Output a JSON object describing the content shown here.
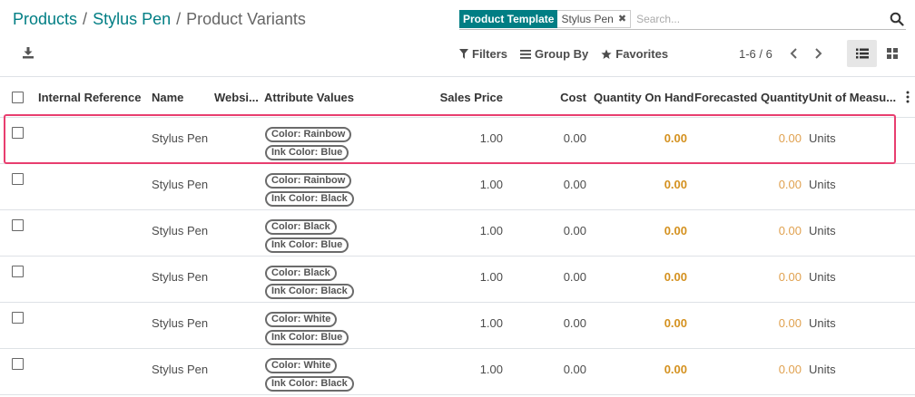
{
  "breadcrumb": {
    "root": "Products",
    "sep1": "/",
    "product": "Stylus Pen",
    "sep2": "/",
    "current": "Product Variants"
  },
  "search": {
    "facet_label": "Product Template",
    "facet_value": "Stylus Pen",
    "placeholder": "Search..."
  },
  "toolbar": {
    "filters": "Filters",
    "group_by": "Group By",
    "favorites": "Favorites",
    "pager": "1-6 / 6"
  },
  "columns": {
    "internal_reference": "Internal Reference",
    "name": "Name",
    "website": "Websi...",
    "attribute_values": "Attribute Values",
    "sales_price": "Sales Price",
    "cost": "Cost",
    "qty_on_hand": "Quantity On Hand",
    "forecasted_qty": "Forecasted Quantity",
    "uom": "Unit of Measu..."
  },
  "rows": [
    {
      "name": "Stylus Pen",
      "tag1": "Color: Rainbow",
      "tag2": "Ink Color: Blue",
      "sales_price": "1.00",
      "cost": "0.00",
      "qty_on_hand": "0.00",
      "forecasted": "0.00",
      "uom": "Units"
    },
    {
      "name": "Stylus Pen",
      "tag1": "Color: Rainbow",
      "tag2": "Ink Color: Black",
      "sales_price": "1.00",
      "cost": "0.00",
      "qty_on_hand": "0.00",
      "forecasted": "0.00",
      "uom": "Units"
    },
    {
      "name": "Stylus Pen",
      "tag1": "Color: Black",
      "tag2": "Ink Color: Blue",
      "sales_price": "1.00",
      "cost": "0.00",
      "qty_on_hand": "0.00",
      "forecasted": "0.00",
      "uom": "Units"
    },
    {
      "name": "Stylus Pen",
      "tag1": "Color: Black",
      "tag2": "Ink Color: Black",
      "sales_price": "1.00",
      "cost": "0.00",
      "qty_on_hand": "0.00",
      "forecasted": "0.00",
      "uom": "Units"
    },
    {
      "name": "Stylus Pen",
      "tag1": "Color: White",
      "tag2": "Ink Color: Blue",
      "sales_price": "1.00",
      "cost": "0.00",
      "qty_on_hand": "0.00",
      "forecasted": "0.00",
      "uom": "Units"
    },
    {
      "name": "Stylus Pen",
      "tag1": "Color: White",
      "tag2": "Ink Color: Black",
      "sales_price": "1.00",
      "cost": "0.00",
      "qty_on_hand": "0.00",
      "forecasted": "0.00",
      "uom": "Units"
    }
  ],
  "colors": {
    "brand": "#017e84",
    "quantity": "#d4911f",
    "highlight": "#e83e6f"
  }
}
